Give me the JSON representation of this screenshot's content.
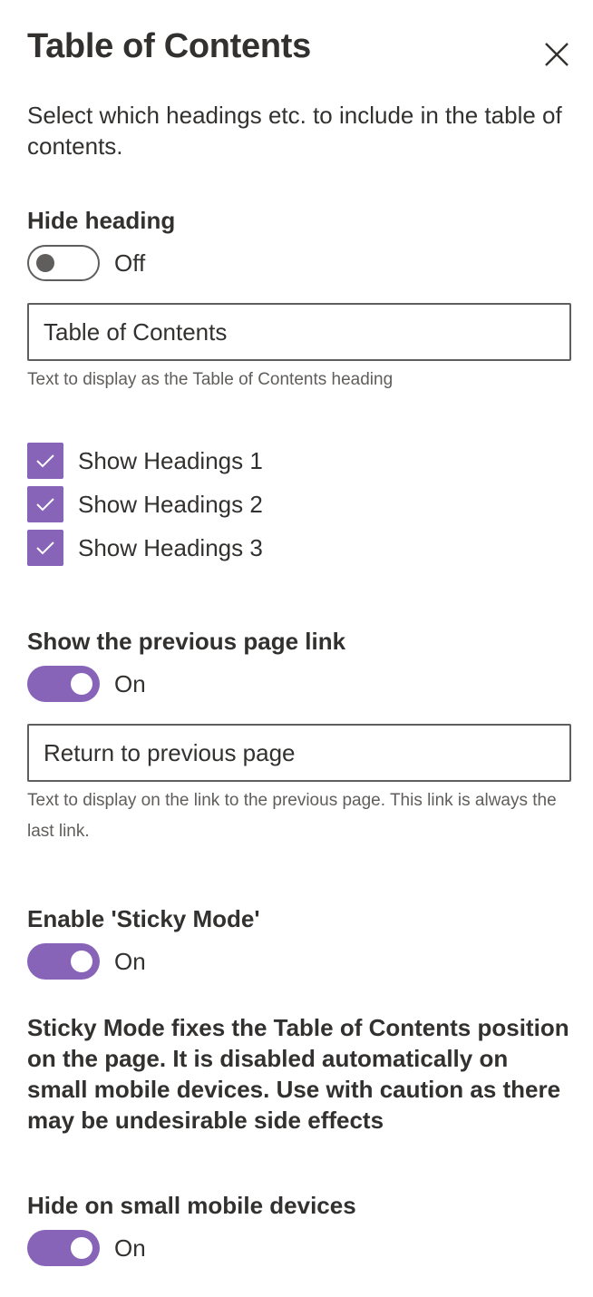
{
  "panel": {
    "title": "Table of Contents",
    "close_icon": "close-icon",
    "description": "Select which headings etc. to include in the table of contents."
  },
  "hide_heading": {
    "label": "Hide heading",
    "state": "Off"
  },
  "heading_text": {
    "value": "Table of Contents",
    "help": "Text to display as the Table of Contents heading"
  },
  "headings": [
    {
      "label": "Show Headings 1",
      "checked": true
    },
    {
      "label": "Show Headings 2",
      "checked": true
    },
    {
      "label": "Show Headings 3",
      "checked": true
    }
  ],
  "previous_link": {
    "label": "Show the previous page link",
    "state": "On",
    "value": "Return to previous page",
    "help": "Text to display on the link to the previous page. This link is always the last link."
  },
  "sticky_mode": {
    "label": "Enable 'Sticky Mode'",
    "state": "On",
    "note": "Sticky Mode fixes the Table of Contents position on the page. It is disabled automatically on small mobile devices. Use with caution as there may be undesirable side effects"
  },
  "hide_mobile": {
    "label": "Hide on small mobile devices",
    "state": "On"
  },
  "colors": {
    "accent": "#8764b8",
    "text": "#323130",
    "secondary_text": "#605e5c"
  }
}
